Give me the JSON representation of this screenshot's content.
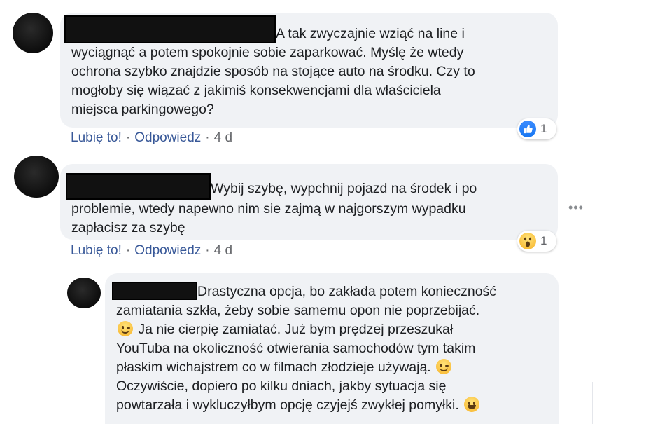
{
  "comments": [
    {
      "text": "A tak zwyczajnie wziąć na line i wyciągnąć a potem spokojnie sobie zaparkować. Myślę że wtedy ochrona szybko znajdzie sposób na stojące auto na środku. Czy to mogłoby się wiązać z jakimiś konsekwencjami dla właściciela miejsca parkingowego?",
      "line1": "A tak zwyczajnie wziąć na line i",
      "line2": "wyciągnąć a potem spokojnie sobie zaparkować. Myślę że wtedy",
      "line3": "ochrona szybko znajdzie sposób na stojące auto na środku. Czy to",
      "line4": "mogłoby się wiązać z jakimiś konsekwencjami dla właściciela",
      "line5": "miejsca parkingowego?",
      "like_label": "Lubię to!",
      "reply_label": "Odpowiedz",
      "time": "4 d",
      "reaction_icon": "like-icon",
      "reaction_count": "1"
    },
    {
      "line1": "Wybij szybę, wypchnij pojazd na środek i po",
      "line2": "problemie, wtedy napewno nim sie zajmą w najgorszym wypadku",
      "line3": "zapłacisz za szybę",
      "like_label": "Lubię to!",
      "reply_label": "Odpowiedz",
      "time": "4 d",
      "reaction_icon": "wow-icon",
      "reaction_count": "1"
    },
    {
      "line1": "Drastyczna opcja, bo zakłada potem konieczność",
      "line2": "zamiatania szkła, żeby sobie samemu opon nie poprzebijać.",
      "line3": "Ja nie cierpię zamiatać. Już bym prędzej przeszukał",
      "line4": "YouTuba na okoliczność otwierania samochodów tym takim",
      "line5": "płaskim wichajstrem co w filmach złodzieje używają.",
      "line6": "Oczywiście, dopiero po kilku dniach, jakby sytuacja się",
      "line7": "powtarzała i wykluczyłbym opcję czyjejś zwykłej pomyłki.",
      "emoji_icons": [
        "wink-emoji-icon",
        "wink-emoji-icon",
        "grin-emoji-icon"
      ]
    }
  ],
  "more_options": "•••",
  "colors": {
    "bubble": "#f0f2f5",
    "link": "#385898",
    "meta": "#65676b",
    "like_blue": "#1877f2"
  }
}
